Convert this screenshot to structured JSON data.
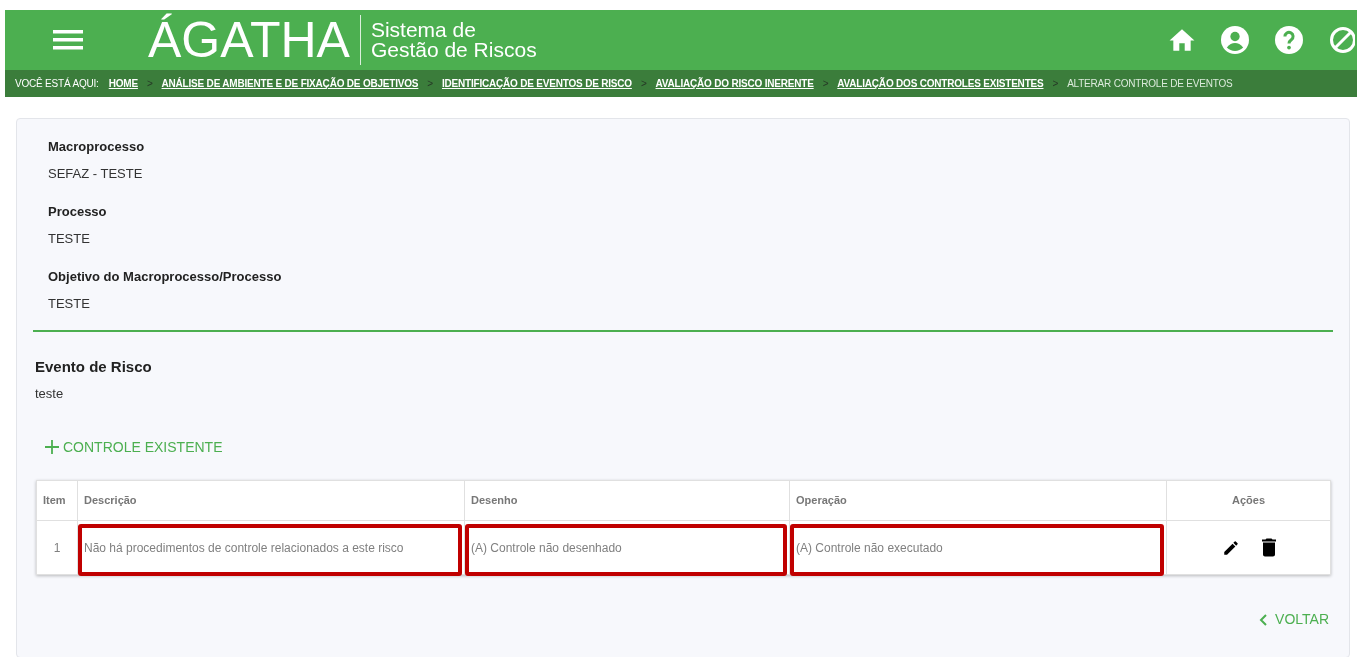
{
  "header": {
    "logo": "ÁGATHA",
    "subtitle_lines": [
      "Sistema de",
      "Gestão de Riscos"
    ]
  },
  "breadcrumb": {
    "label": "VOCÊ ESTÁ AQUI:",
    "items": [
      {
        "text": "HOME",
        "current": false
      },
      {
        "text": "ANÁLISE DE AMBIENTE E DE FIXAÇÃO DE OBJETIVOS",
        "current": false
      },
      {
        "text": "IDENTIFICAÇÃO DE EVENTOS DE RISCO",
        "current": false
      },
      {
        "text": "AVALIAÇÃO DO RISCO INERENTE",
        "current": false
      },
      {
        "text": "AVALIAÇÃO DOS CONTROLES EXISTENTES",
        "current": false
      },
      {
        "text": "ALTERAR CONTROLE DE EVENTOS",
        "current": true
      }
    ],
    "separator": ">"
  },
  "fields": [
    {
      "label": "Macroprocesso",
      "value": "SEFAZ - TESTE"
    },
    {
      "label": "Processo",
      "value": "TESTE"
    },
    {
      "label": "Objetivo do Macroprocesso/Processo",
      "value": "TESTE"
    }
  ],
  "risk_event": {
    "label": "Evento de Risco",
    "value": "teste"
  },
  "add_button": "CONTROLE EXISTENTE",
  "table": {
    "columns": [
      "Item",
      "Descrição",
      "Desenho",
      "Operação",
      "Ações"
    ],
    "rows": [
      {
        "cells": [
          {
            "text": "1",
            "highlighted": false
          },
          {
            "text": "Não há procedimentos de controle relacionados a este risco",
            "highlighted": true
          },
          {
            "text": "(A) Controle não desenhado",
            "highlighted": true
          },
          {
            "text": "(A) Controle não executado",
            "highlighted": true
          }
        ]
      }
    ]
  },
  "back_button": "VOLTAR"
}
